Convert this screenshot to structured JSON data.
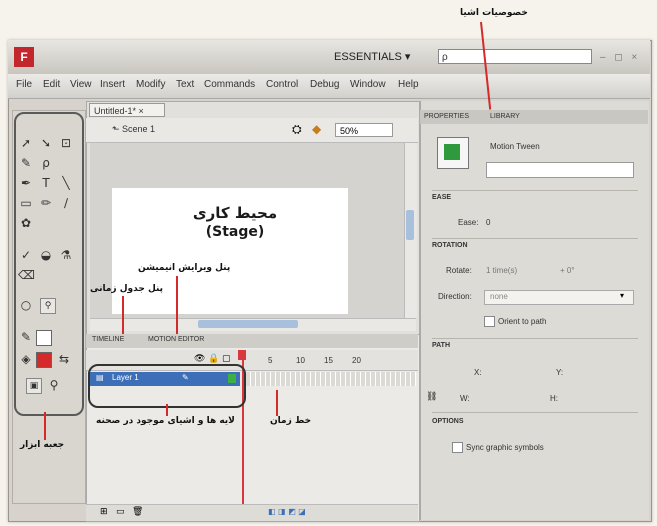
{
  "app": {
    "logo_letter": "F",
    "workspace": "ESSENTIALS ▾",
    "search_text": "ρ",
    "window_controls": "– ◻ ×"
  },
  "menu": [
    "File",
    "Edit",
    "View",
    "Insert",
    "Modify",
    "Text",
    "Commands",
    "Control",
    "Debug",
    "Window",
    "Help"
  ],
  "document": {
    "tab": "Untitled-1* ×",
    "scene": "Scene 1",
    "zoom": "50%"
  },
  "stage": {
    "label_fa": "محیط کاری",
    "label_en": "(Stage)"
  },
  "timeline": {
    "tab_timeline": "TIMELINE",
    "tab_motion": "MOTION EDITOR",
    "layer_name": "Layer 1",
    "frame_numbers": [
      "5",
      "10",
      "15",
      "20"
    ]
  },
  "properties": {
    "tab_properties": "PROPERTIES",
    "tab_library": "LIBRARY",
    "title": "Motion Tween",
    "ease_section": "EASE",
    "ease_label": "Ease:",
    "ease_value": "0",
    "rotation_section": "ROTATION",
    "rotate_label": "Rotate:",
    "rotate_value": "1 time(s)",
    "rotate_extra": "+ 0°",
    "direction_label": "Direction:",
    "direction_value": "none",
    "orient": "Orient to path",
    "path_section": "PATH",
    "x_label": "X:",
    "y_label": "Y:",
    "w_label": "W:",
    "h_label": "H:",
    "options_section": "OPTIONS",
    "sync": "Sync graphic symbols"
  },
  "callouts": {
    "properties_panel": "خصوصیات اشیا",
    "motion_panel": "پنل ویرایش انیمیشن",
    "timeline_panel": "پنل جدول زمانی",
    "layers": "لایه ها و اشیای موجود در صحنه",
    "time_line": "خط زمان",
    "toolbox": "جعبه ابزار"
  },
  "colors": {
    "accent_red": "#d42a2a",
    "layer_selected": "#3d6fb8",
    "logo_red": "#c1272d"
  }
}
